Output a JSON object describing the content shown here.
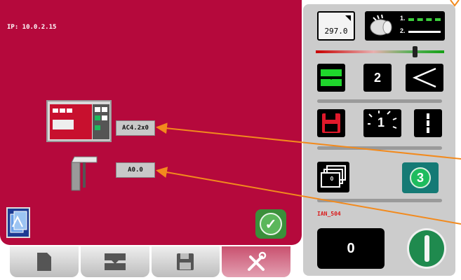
{
  "status": {
    "ip_label": "IP: 10.0.2.15"
  },
  "main": {
    "code_primary": "AC4.2x0",
    "code_secondary": "A0.0"
  },
  "right_panel": {
    "paper_value": "297.0",
    "program_number": "2",
    "copies_badge": "3",
    "error_label": "IAN_504",
    "counter_value": "0",
    "stepper_small_label": "0",
    "dial_number": "1",
    "line_labels": [
      "1.",
      "2."
    ]
  },
  "bottom_tabs": [
    {
      "icon": "document-icon"
    },
    {
      "icon": "fold-icon"
    },
    {
      "icon": "save-icon"
    },
    {
      "icon": "tools-icon"
    }
  ],
  "colors": {
    "main_background": "#b5093c",
    "right_panel_background": "#cccccc",
    "accent_orange": "#f28a1d",
    "error_red": "#d91a1a",
    "start_green": "#1f8a4e"
  }
}
